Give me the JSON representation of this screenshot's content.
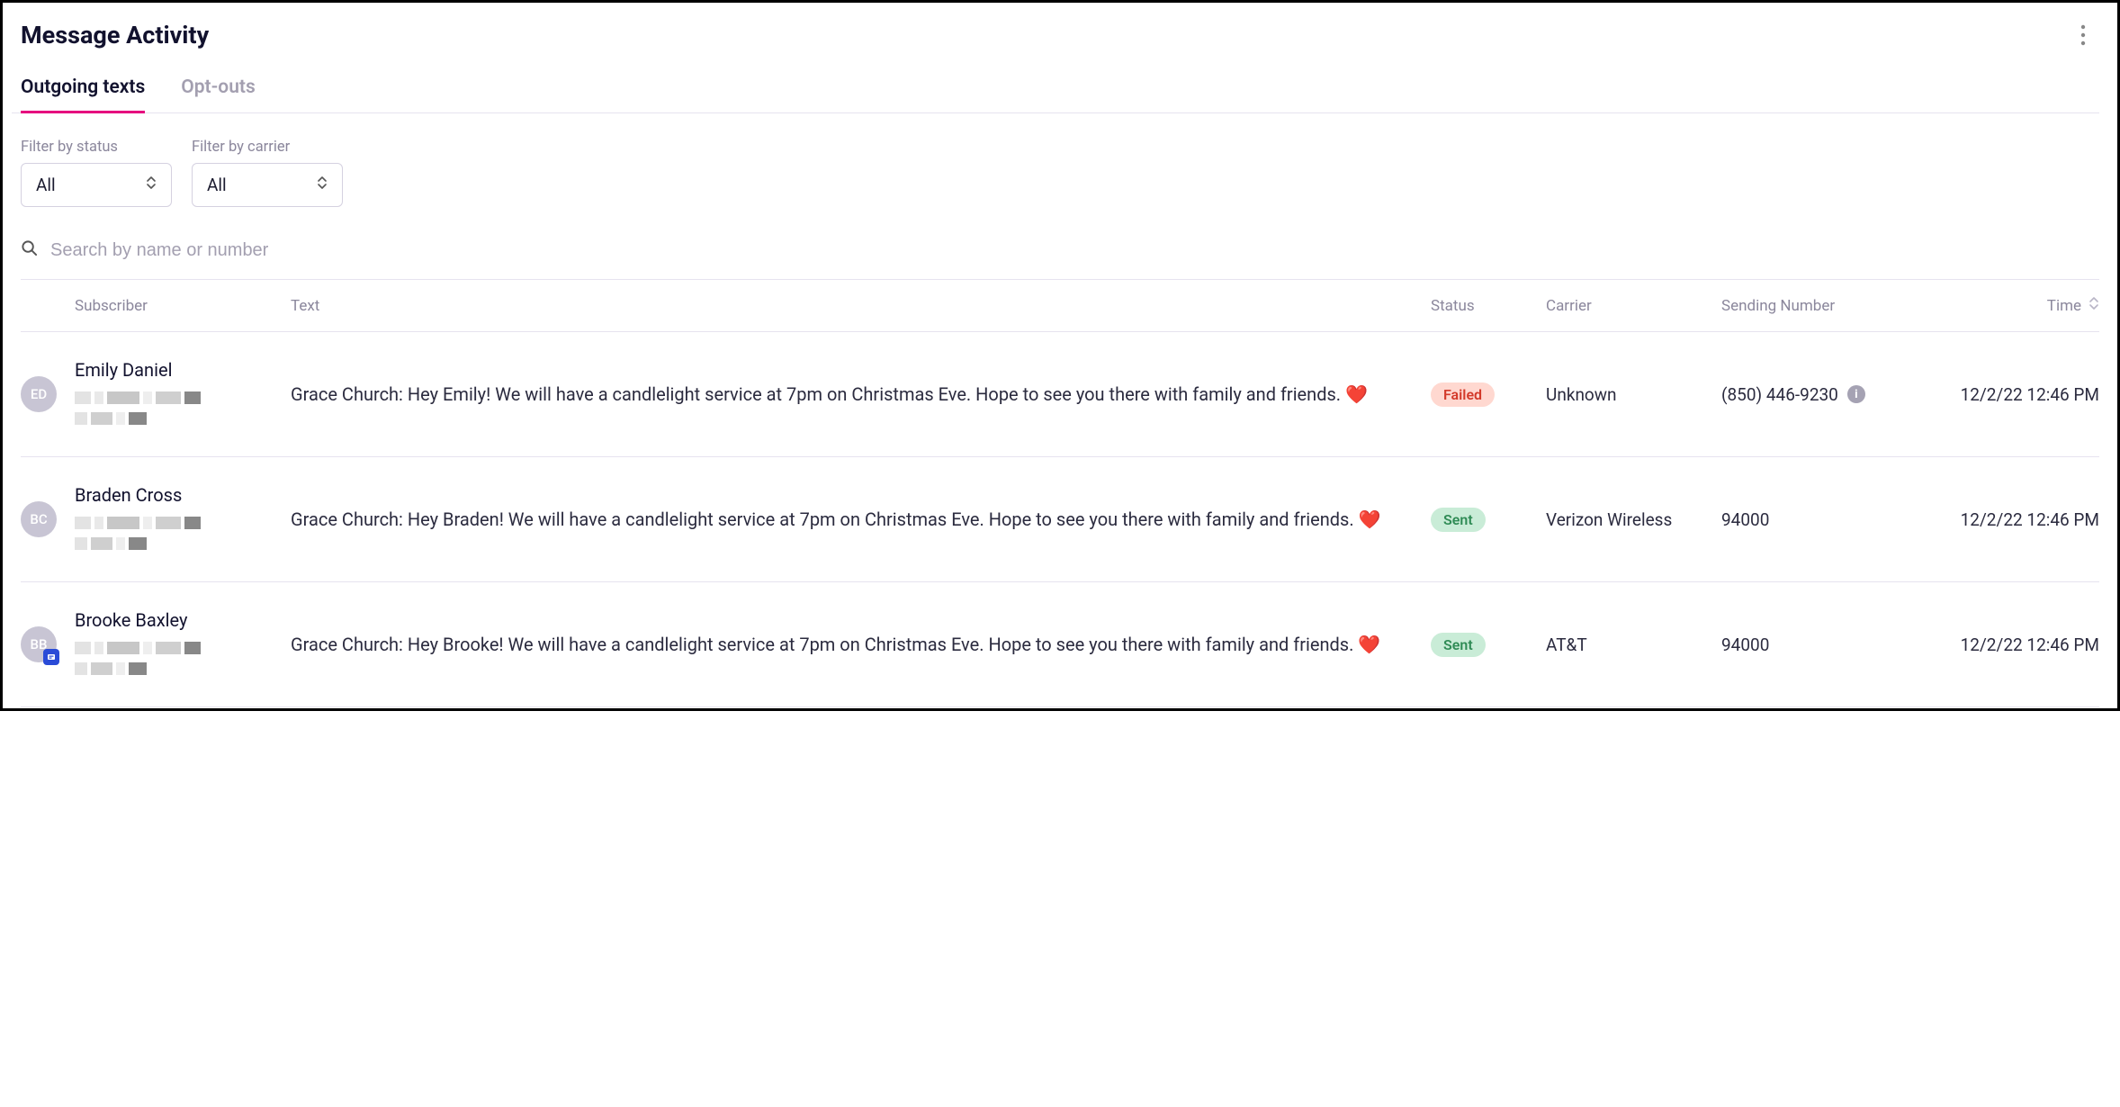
{
  "header": {
    "title": "Message Activity"
  },
  "tabs": [
    {
      "label": "Outgoing texts",
      "active": true
    },
    {
      "label": "Opt-outs",
      "active": false
    }
  ],
  "filters": {
    "status": {
      "label": "Filter by status",
      "value": "All"
    },
    "carrier": {
      "label": "Filter by carrier",
      "value": "All"
    }
  },
  "search": {
    "placeholder": "Search by name or number"
  },
  "columns": {
    "subscriber": "Subscriber",
    "text": "Text",
    "status": "Status",
    "carrier": "Carrier",
    "sending_number": "Sending Number",
    "time": "Time"
  },
  "rows": [
    {
      "initials": "ED",
      "name": "Emily Daniel",
      "text": "Grace Church: Hey Emily! We will have a candlelight service at 7pm on Christmas Eve. Hope to see you there with family and friends. ❤️",
      "status": "Failed",
      "status_kind": "failed",
      "carrier": "Unknown",
      "sending_number": "(850) 446-9230",
      "has_info": true,
      "time": "12/2/22 12:46 PM",
      "has_badge": false
    },
    {
      "initials": "BC",
      "name": "Braden Cross",
      "text": "Grace Church: Hey Braden! We will have a candlelight service at 7pm on Christmas Eve. Hope to see you there with family and friends. ❤️",
      "status": "Sent",
      "status_kind": "sent",
      "carrier": "Verizon Wireless",
      "sending_number": "94000",
      "has_info": false,
      "time": "12/2/22 12:46 PM",
      "has_badge": false
    },
    {
      "initials": "BB",
      "name": "Brooke Baxley",
      "text": "Grace Church: Hey Brooke! We will have a candlelight service at 7pm on Christmas Eve. Hope to see you there with family and friends. ❤️",
      "status": "Sent",
      "status_kind": "sent",
      "carrier": "AT&T",
      "sending_number": "94000",
      "has_info": false,
      "time": "12/2/22 12:46 PM",
      "has_badge": true
    }
  ]
}
